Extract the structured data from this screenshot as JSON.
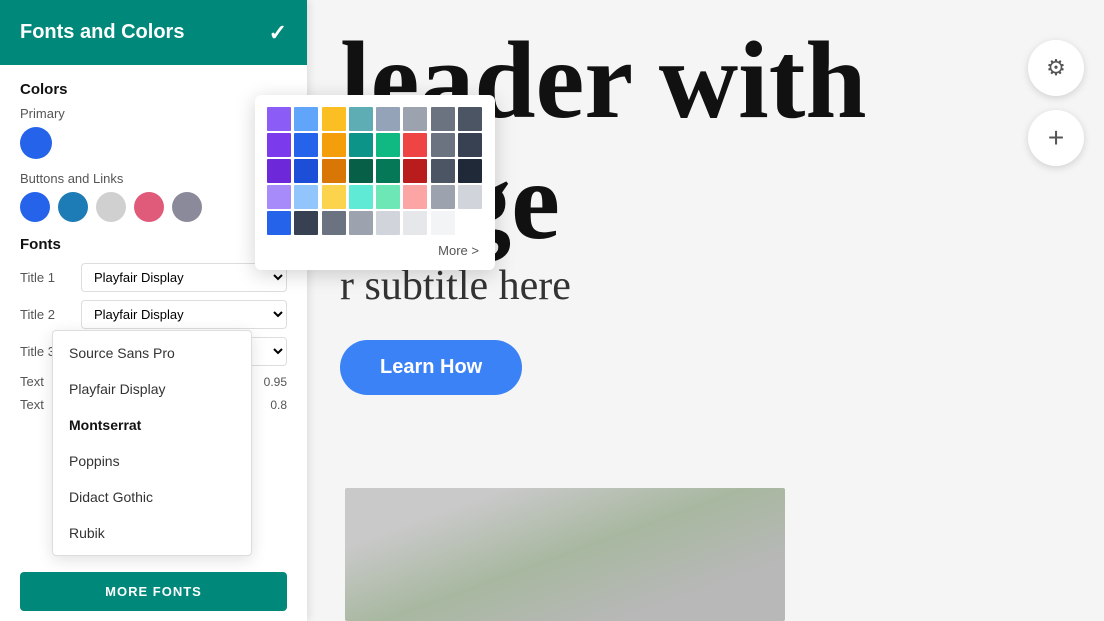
{
  "panel": {
    "title": "Fonts and Colors",
    "check_label": "✓",
    "colors": {
      "section_title": "Colors",
      "primary_label": "Primary",
      "buttons_links_label": "Buttons and  Links",
      "swatches": [
        {
          "color": "#2563eb",
          "name": "blue"
        },
        {
          "color": "#1d7bb5",
          "name": "dark-blue"
        },
        {
          "color": "#d0d0d0",
          "name": "light-gray"
        },
        {
          "color": "#e05a7a",
          "name": "pink"
        },
        {
          "color": "#8a8a9a",
          "name": "gray"
        }
      ]
    },
    "fonts": {
      "section_title": "Fonts",
      "rows": [
        {
          "label": "Title 1",
          "value": "Playfair Display",
          "size": null
        },
        {
          "label": "Title 2",
          "value": "Playfair Display",
          "size": null
        },
        {
          "label": "Title 3",
          "value": "Montserrat",
          "size": null
        },
        {
          "label": "Text",
          "value": "Source Sans Pro",
          "size": "0.95"
        },
        {
          "label": "Text",
          "value": "Playfair Display",
          "size": "0.8"
        }
      ],
      "dropdown_items": [
        {
          "label": "Source Sans Pro",
          "selected": false
        },
        {
          "label": "Playfair Display",
          "selected": false
        },
        {
          "label": "Montserrat",
          "selected": true
        },
        {
          "label": "Poppins",
          "selected": false
        },
        {
          "label": "Didact Gothic",
          "selected": false
        },
        {
          "label": "Rubik",
          "selected": false
        }
      ],
      "more_fonts_label": "MORE FONTS"
    }
  },
  "hero": {
    "line1": "leader with",
    "line2": "nage",
    "subtitle": "r subtitle here",
    "button_label": "Learn How"
  },
  "palette": {
    "more_label": "More >",
    "colors": [
      "#8b5cf6",
      "#60a5fa",
      "#fbbf24",
      "#5eadb5",
      "#94a3b8",
      "#9ca3af",
      "#6b7280",
      "#4b5563",
      "#7c3aed",
      "#2563eb",
      "#f59e0b",
      "#0d9488",
      "#10b981",
      "#ef4444",
      "#6b7280",
      "#374151",
      "#6d28d9",
      "#1d4ed8",
      "#d97706",
      "#065f46",
      "#047857",
      "#b91c1c",
      "#4b5563",
      "#1f2937",
      "#a78bfa",
      "#93c5fd",
      "#fcd34d",
      "#5eead4",
      "#6ee7b7",
      "#fca5a5",
      "#9ca3af",
      "#d1d5db",
      "#2563eb",
      "#374151",
      "#6b7280",
      "#9ca3af",
      "#d1d5db",
      "#e5e7eb",
      "#f3f4f6",
      "#ffffff"
    ]
  },
  "icons": {
    "gear": "⚙",
    "plus": "+"
  }
}
